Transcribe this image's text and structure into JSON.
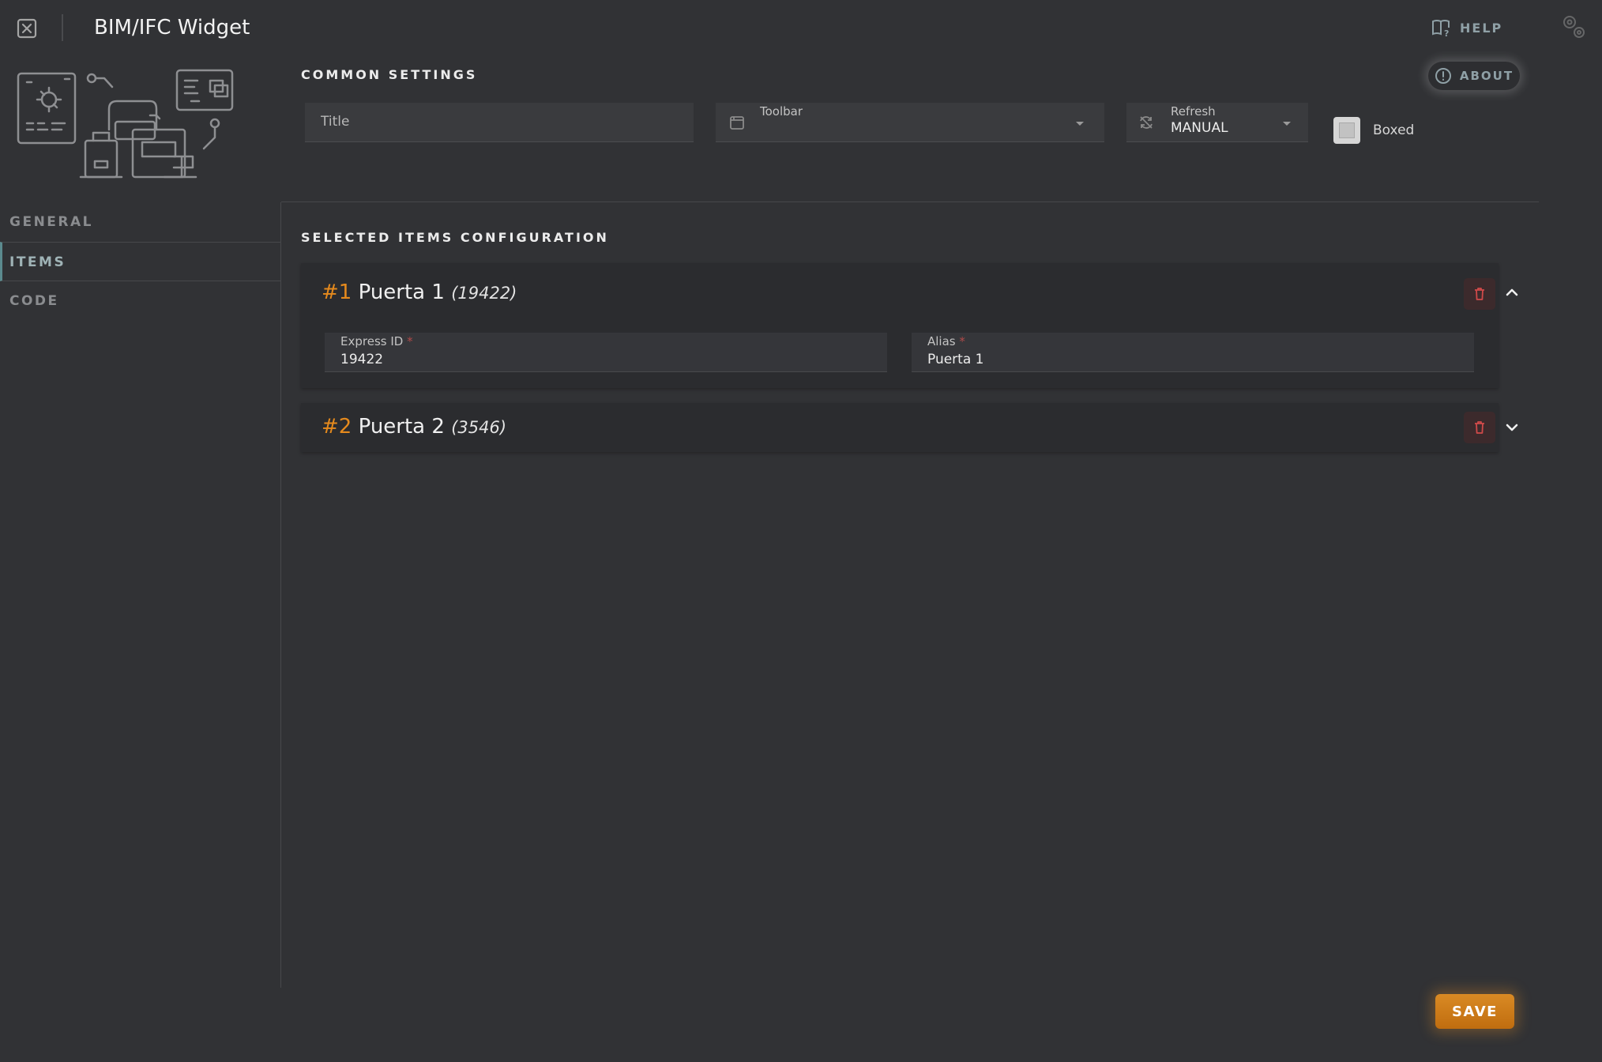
{
  "header": {
    "title": "BIM/IFC Widget",
    "help_label": "HELP"
  },
  "sidebar": {
    "items": [
      {
        "label": "GENERAL",
        "active": false
      },
      {
        "label": "ITEMS",
        "active": true
      },
      {
        "label": "CODE",
        "active": false
      }
    ]
  },
  "common": {
    "title": "COMMON SETTINGS",
    "about_label": "ABOUT",
    "title_placeholder": "Title",
    "toolbar_label": "Toolbar",
    "toolbar_value": "",
    "refresh_label": "Refresh",
    "refresh_value": "MANUAL",
    "boxed_label": "Boxed",
    "boxed_checked": false
  },
  "selected": {
    "title": "SELECTED ITEMS CONFIGURATION",
    "items": [
      {
        "num": "#1",
        "name": "Puerta 1",
        "sub": "(19422)",
        "expanded": true,
        "express_id_label": "Express ID",
        "express_id": "19422",
        "alias_label": "Alias",
        "alias": "Puerta 1"
      },
      {
        "num": "#2",
        "name": "Puerta 2",
        "sub": "(3546)",
        "expanded": false
      }
    ],
    "required_mark": "*"
  },
  "save_label": "SAVE",
  "colors": {
    "accent": "#e58a1d",
    "teal": "#5b8a8e",
    "danger": "#c84848",
    "background": "#313235"
  }
}
